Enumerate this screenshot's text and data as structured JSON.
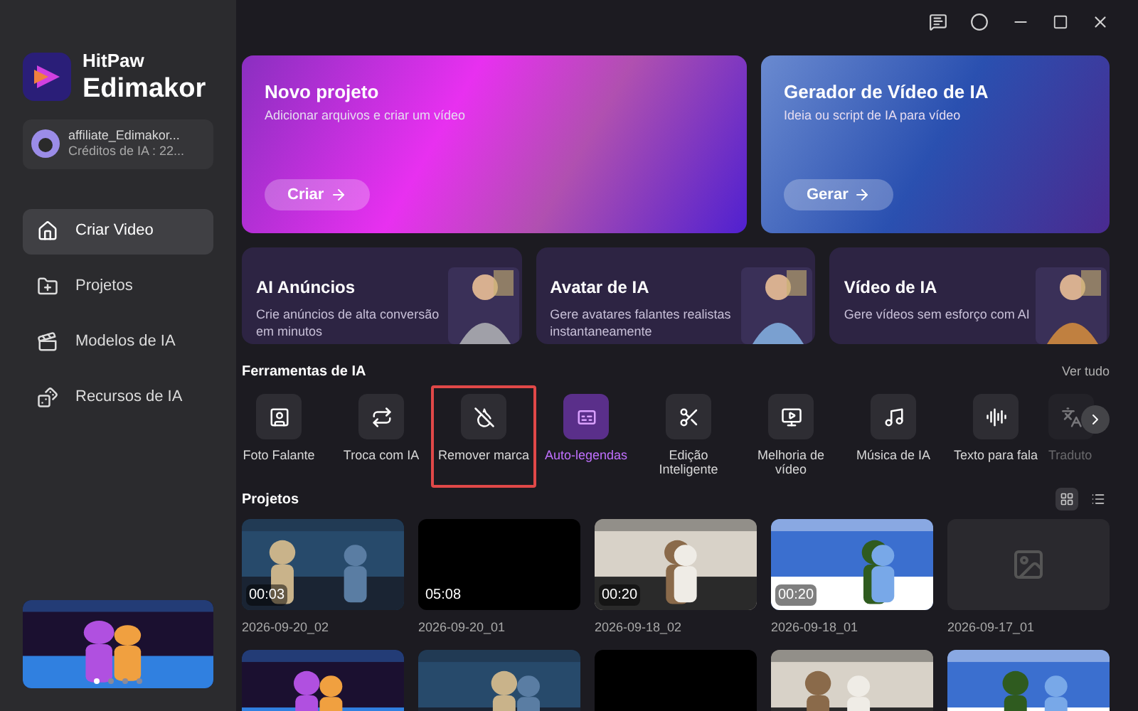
{
  "sidebar": {
    "brand": {
      "line1": "HitPaw",
      "line2": "Edimakor"
    },
    "account": {
      "name": "affiliate_Edimakor...",
      "credits": "Créditos de IA : 22..."
    },
    "nav": [
      {
        "label": "Criar Video",
        "selected": true,
        "kind": "home"
      },
      {
        "label": "Projetos",
        "selected": false,
        "kind": "folder"
      },
      {
        "label": "Modelos de IA",
        "selected": false,
        "kind": "template"
      },
      {
        "label": "Recursos de IA",
        "selected": false,
        "kind": "dice"
      }
    ],
    "banner": {
      "kind": "picture",
      "dots": [
        {
          "selected": true
        },
        {
          "selected": false
        },
        {
          "selected": false
        },
        {
          "selected": false
        }
      ]
    }
  },
  "hero_cards": [
    {
      "title": "Novo projeto",
      "subtitle": "Adicionar arquivos e criar um vídeo",
      "button": "Criar",
      "kind": "pink"
    },
    {
      "title": "Gerador de Vídeo de IA",
      "subtitle": "Ideia ou script de IA para vídeo",
      "button": "Gerar",
      "kind": "blue"
    }
  ],
  "feature_cards": [
    {
      "title": "AI Anúncios",
      "description": "Crie anúncios de alta conversão em minutos"
    },
    {
      "title": "Avatar de IA",
      "description": "Gere avatares falantes realistas instantaneamente"
    },
    {
      "title": "Vídeo de IA",
      "description": "Gere vídeos sem esforço com AI"
    }
  ],
  "tools": {
    "heading": "Ferramentas de IA",
    "see_all": "Ver tudo",
    "items": [
      {
        "label": "Foto Falante",
        "kind": "portrait",
        "selected": false,
        "outlined": false
      },
      {
        "label": "Troca com IA",
        "kind": "swap",
        "selected": false,
        "outlined": false
      },
      {
        "label": "Remover marca",
        "kind": "erase",
        "selected": false,
        "outlined": true
      },
      {
        "label": "Auto-legendas",
        "kind": "captions",
        "selected": true,
        "outlined": false
      },
      {
        "label": "Edição Inteligente",
        "kind": "scissors",
        "selected": false,
        "outlined": false
      },
      {
        "label": "Melhoria de vídeo",
        "kind": "video",
        "selected": false,
        "outlined": false
      },
      {
        "label": "Música de IA",
        "kind": "music",
        "selected": false,
        "outlined": false
      },
      {
        "label": "Texto para fala",
        "kind": "speech",
        "selected": false,
        "outlined": false
      },
      {
        "label": "Traduto",
        "kind": "translate",
        "selected": false,
        "outlined": false
      }
    ]
  },
  "projects": {
    "heading": "Projetos",
    "views": [
      {
        "kind": "grid",
        "selected": true
      },
      {
        "kind": "list",
        "selected": false
      }
    ],
    "items": [
      {
        "kind": "picture",
        "duration": "00:03",
        "date": "2026-09-20_02"
      },
      {
        "kind": "black",
        "duration": "05:08",
        "date": "2026-09-20_01"
      },
      {
        "kind": "picture",
        "duration": "00:20",
        "date": "2026-09-18_02"
      },
      {
        "kind": "picture",
        "duration": "00:20",
        "date": "2026-09-18_01"
      },
      {
        "kind": "empty",
        "date": "2026-09-17_01"
      },
      {
        "kind": "picture"
      },
      {
        "kind": "picture"
      },
      {
        "kind": "black"
      },
      {
        "kind": "picture"
      },
      {
        "kind": "picture"
      }
    ]
  }
}
